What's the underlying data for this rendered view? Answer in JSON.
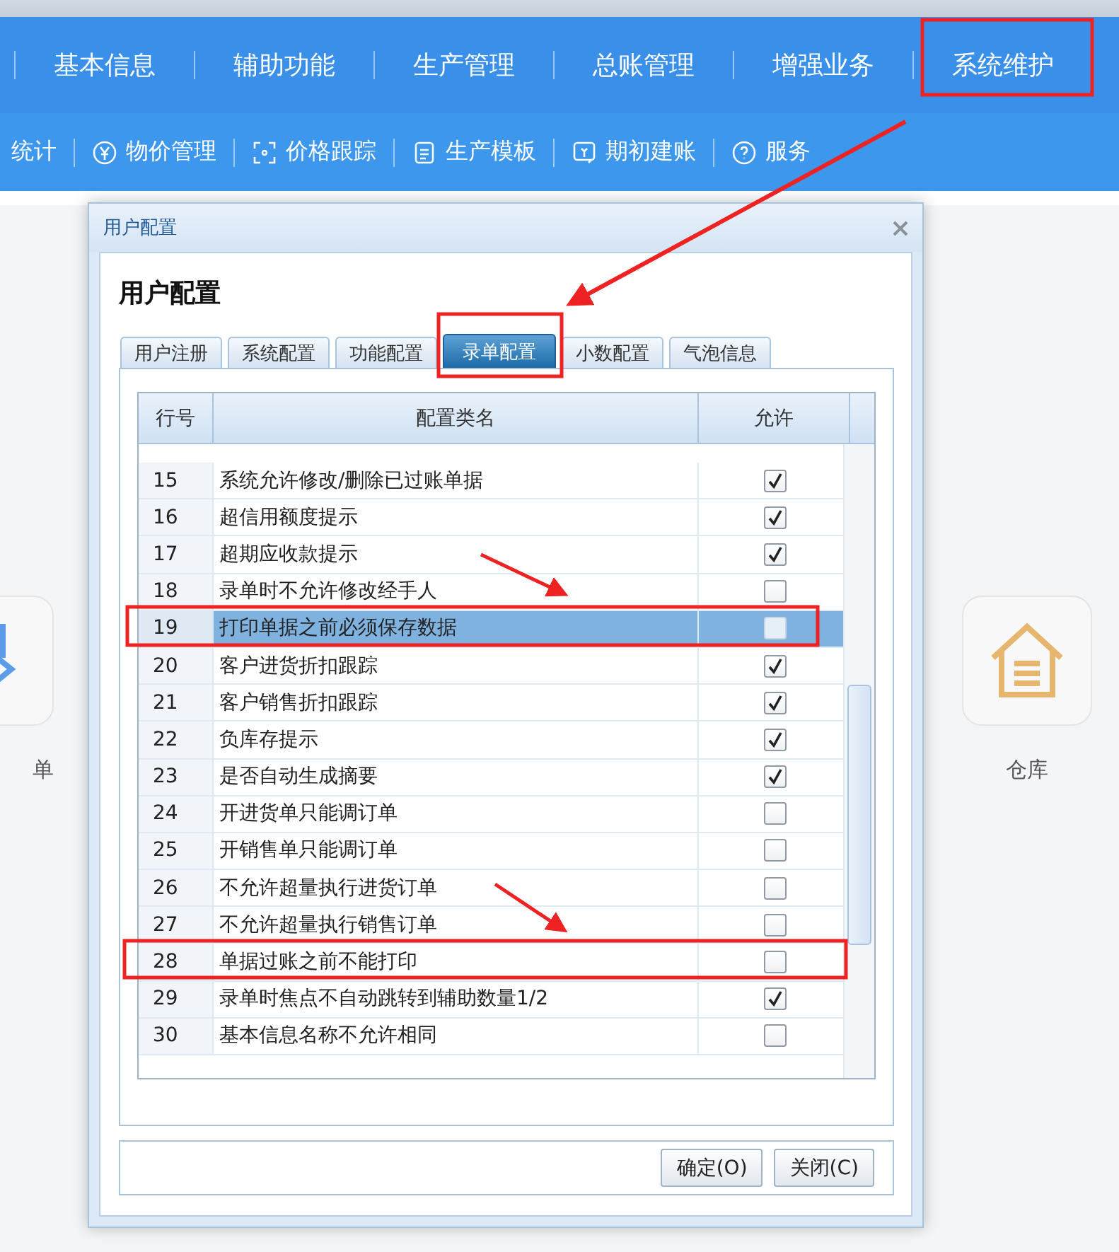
{
  "top_nav": [
    {
      "label": "基本信息"
    },
    {
      "label": "辅助功能"
    },
    {
      "label": "生产管理"
    },
    {
      "label": "总账管理"
    },
    {
      "label": "增强业务"
    },
    {
      "label": "系统维护"
    }
  ],
  "sub_nav": [
    {
      "label": "统计"
    },
    {
      "label": "物价管理"
    },
    {
      "label": "价格跟踪"
    },
    {
      "label": "生产模板"
    },
    {
      "label": "期初建账"
    },
    {
      "label": "服务"
    }
  ],
  "tiles": [
    {
      "label": "单"
    },
    {
      "label": "仓库"
    }
  ],
  "dialog": {
    "title": "用户配置",
    "heading": "用户配置",
    "tabs": [
      {
        "label": "用户注册",
        "selected": false
      },
      {
        "label": "系统配置",
        "selected": false
      },
      {
        "label": "功能配置",
        "selected": false
      },
      {
        "label": "录单配置",
        "selected": true
      },
      {
        "label": "小数配置",
        "selected": false
      },
      {
        "label": "气泡信息",
        "selected": false
      }
    ],
    "columns": [
      "行号",
      "配置类名",
      "允许"
    ],
    "rows": [
      {
        "no": "15",
        "name": "系统允许修改/删除已过账单据",
        "checked": true,
        "selected": false
      },
      {
        "no": "16",
        "name": "超信用额度提示",
        "checked": true,
        "selected": false
      },
      {
        "no": "17",
        "name": "超期应收款提示",
        "checked": true,
        "selected": false
      },
      {
        "no": "18",
        "name": "录单时不允许修改经手人",
        "checked": false,
        "selected": false
      },
      {
        "no": "19",
        "name": "打印单据之前必须保存数据",
        "checked": false,
        "selected": true
      },
      {
        "no": "20",
        "name": "客户进货折扣跟踪",
        "checked": true,
        "selected": false
      },
      {
        "no": "21",
        "name": "客户销售折扣跟踪",
        "checked": true,
        "selected": false
      },
      {
        "no": "22",
        "name": "负库存提示",
        "checked": true,
        "selected": false
      },
      {
        "no": "23",
        "name": "是否自动生成摘要",
        "checked": true,
        "selected": false
      },
      {
        "no": "24",
        "name": "开进货单只能调订单",
        "checked": false,
        "selected": false
      },
      {
        "no": "25",
        "name": "开销售单只能调订单",
        "checked": false,
        "selected": false
      },
      {
        "no": "26",
        "name": "不允许超量执行进货订单",
        "checked": false,
        "selected": false
      },
      {
        "no": "27",
        "name": "不允许超量执行销售订单",
        "checked": false,
        "selected": false
      },
      {
        "no": "28",
        "name": "单据过账之前不能打印",
        "checked": false,
        "selected": false
      },
      {
        "no": "29",
        "name": "录单时焦点不自动跳转到辅助数量1/2",
        "checked": true,
        "selected": false
      },
      {
        "no": "30",
        "name": "基本信息名称不允许相同",
        "checked": false,
        "selected": false
      }
    ],
    "buttons": [
      "确定(O)",
      "关闭(C)"
    ]
  }
}
